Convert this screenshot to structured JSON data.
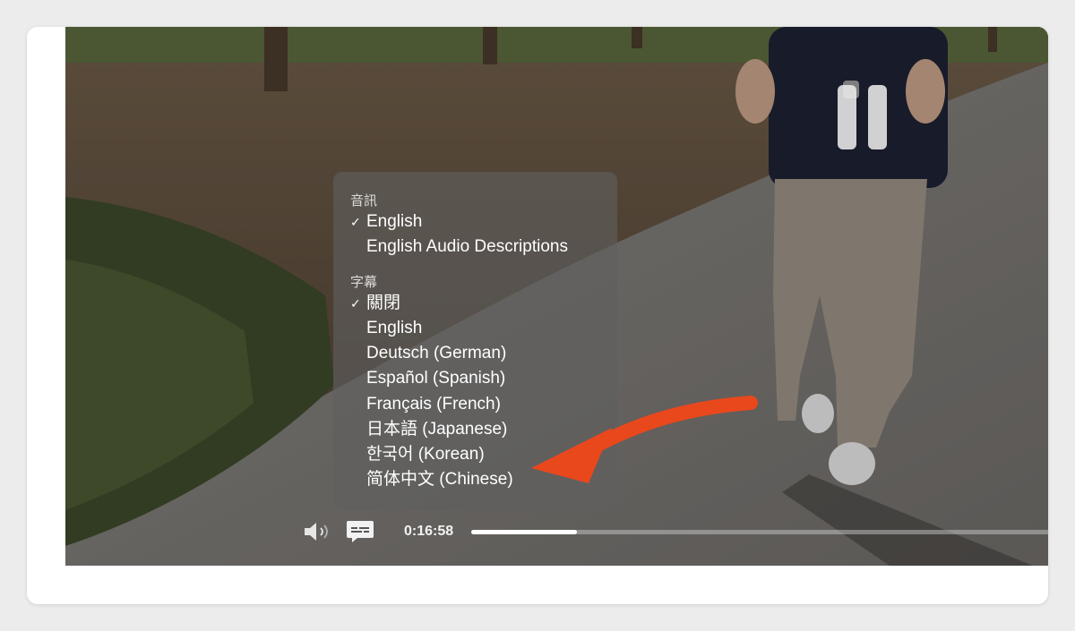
{
  "player": {
    "current_time": "0:16:58",
    "progress_fraction": 0.179,
    "state": "playing",
    "icons": {
      "pause": "pause-icon",
      "volume": "speaker-volume-icon",
      "captions": "subtitles-icon"
    }
  },
  "menu": {
    "audio_header": "音訊",
    "audio_items": [
      {
        "label": "English",
        "checked": true
      },
      {
        "label": "English Audio Descriptions",
        "checked": false
      }
    ],
    "subtitles_header": "字幕",
    "subtitle_items": [
      {
        "label": "關閉",
        "checked": true
      },
      {
        "label": "English",
        "checked": false
      },
      {
        "label": "Deutsch (German)",
        "checked": false
      },
      {
        "label": "Español (Spanish)",
        "checked": false
      },
      {
        "label": "Français (French)",
        "checked": false
      },
      {
        "label": "日本語 (Japanese)",
        "checked": false
      },
      {
        "label": "한국어 (Korean)",
        "checked": false
      },
      {
        "label": "简体中文 (Chinese)",
        "checked": false
      }
    ],
    "check_glyph": "✓"
  },
  "annotation": {
    "color": "#e8481c",
    "points_to": "简体中文 (Chinese)"
  },
  "colors": {
    "accent": "#e8481c",
    "menu_bg": "#606060",
    "text": "#ffffff"
  }
}
